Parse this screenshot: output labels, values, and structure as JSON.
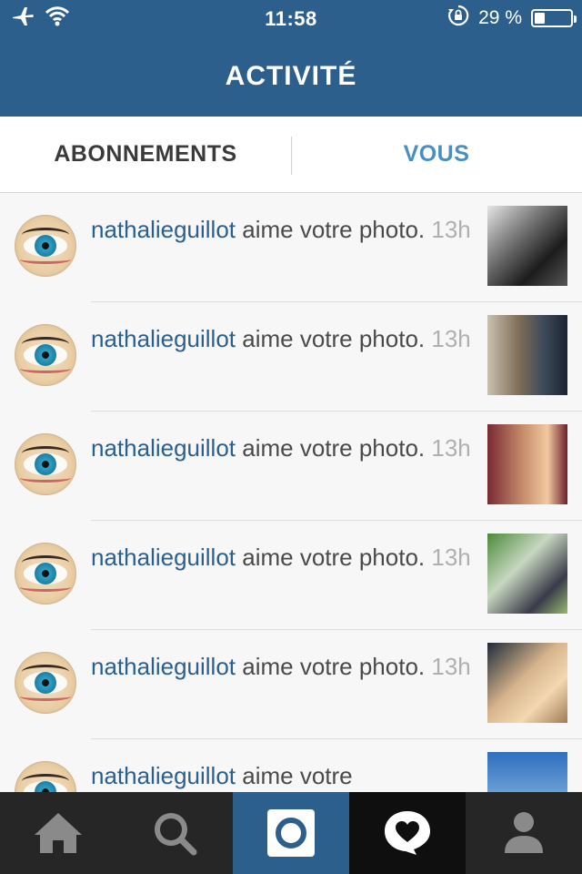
{
  "status_bar": {
    "time": "11:58",
    "battery_text": "29 %",
    "battery_level": 0.29,
    "icons": [
      "airplane-icon",
      "wifi-icon",
      "orientation-lock-icon",
      "battery-icon"
    ]
  },
  "header": {
    "title": "ACTIVITÉ"
  },
  "tabs": [
    {
      "label": "ABONNEMENTS",
      "active": false
    },
    {
      "label": "VOUS",
      "active": true
    }
  ],
  "activity": {
    "items": [
      {
        "username": "nathalieguillot",
        "action": " aime votre photo.",
        "time": "13h"
      },
      {
        "username": "nathalieguillot",
        "action": " aime votre photo.",
        "time": "13h"
      },
      {
        "username": "nathalieguillot",
        "action": " aime votre photo.",
        "time": "13h"
      },
      {
        "username": "nathalieguillot",
        "action": " aime votre photo.",
        "time": "13h"
      },
      {
        "username": "nathalieguillot",
        "action": " aime votre photo.",
        "time": "13h"
      },
      {
        "username": "nathalieguillot",
        "action": " aime votre",
        "time": ""
      }
    ]
  },
  "tabbar": {
    "items": [
      {
        "icon": "home-icon"
      },
      {
        "icon": "search-icon"
      },
      {
        "icon": "camera-icon"
      },
      {
        "icon": "activity-heart-icon"
      },
      {
        "icon": "profile-icon"
      }
    ]
  },
  "colors": {
    "brand_blue": "#2d5f8d",
    "username_blue": "#2a5f8e",
    "tab_active": "#4a8fc3",
    "tabbar_bg": "#262626"
  }
}
